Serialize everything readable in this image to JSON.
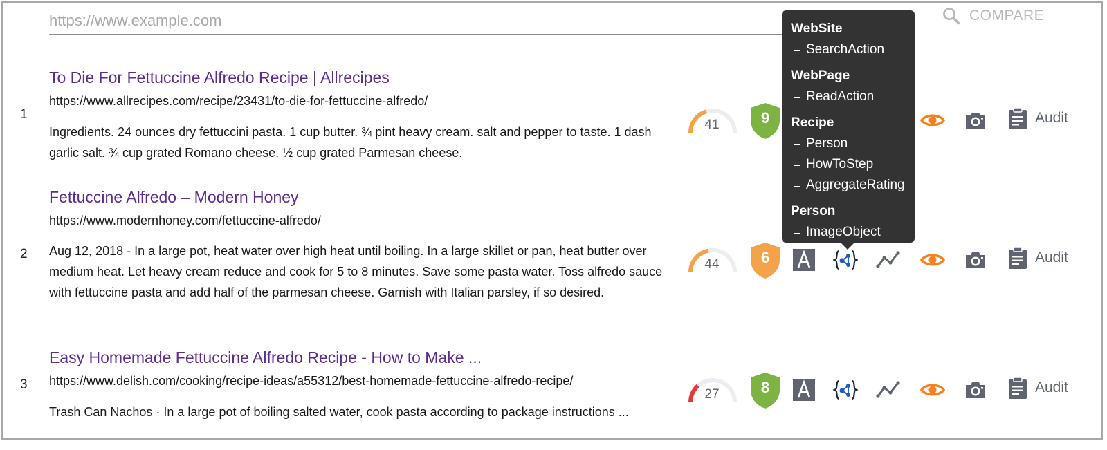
{
  "search": {
    "placeholder": "https://www.example.com",
    "value": ""
  },
  "compare_label": "COMPARE",
  "audit_label": "Audit",
  "colors": {
    "title": "#5c2d91",
    "gauge_orange": "#f5a34a",
    "gauge_red": "#e53935",
    "shield_green": "#7cb342",
    "shield_orange": "#f5a34a",
    "eye_orange": "#f5821f",
    "icon_gray": "#5f6470",
    "schema_blue": "#1e5bc6",
    "tooltip_bg": "#333333"
  },
  "results": [
    {
      "rank": "1",
      "title": "To Die For Fettuccine Alfredo Recipe | Allrecipes",
      "url": "https://www.allrecipes.com/recipe/23431/to-die-for-fettuccine-alfredo/",
      "snippet": "Ingredients. 24 ounces dry fettuccini pasta. 1 cup butter. ¾ pint heavy cream. salt and pepper to taste. 1 dash garlic salt. ¾ cup grated Romano cheese. ½ cup grated Parmesan cheese.",
      "score": "41",
      "score_fraction": 0.41,
      "score_level": "orange",
      "shield": "9",
      "shield_level": "green"
    },
    {
      "rank": "2",
      "title": "Fettuccine Alfredo – Modern Honey",
      "url": "https://www.modernhoney.com/fettuccine-alfredo/",
      "snippet": "Aug 12, 2018 - In a large pot, heat water over high heat until boiling. In a large skillet or pan, heat butter over medium heat. Let heavy cream reduce and cook for 5 to 8 minutes. Save some pasta water. Toss alfredo sauce with fettuccine pasta and add half of the parmesan cheese. Garnish with Italian parsley, if so desired.",
      "score": "44",
      "score_fraction": 0.44,
      "score_level": "orange",
      "shield": "6",
      "shield_level": "orange"
    },
    {
      "rank": "3",
      "title": "Easy Homemade Fettuccine Alfredo Recipe - How to Make ...",
      "url": "https://www.delish.com/cooking/recipe-ideas/a55312/best-homemade-fettuccine-alfredo-recipe/",
      "snippet": "Trash Can Nachos · In a large pot of boiling salted water, cook pasta according to package instructions ...",
      "score": "27",
      "score_fraction": 0.27,
      "score_level": "red",
      "shield": "8",
      "shield_level": "green"
    }
  ],
  "tooltip": [
    {
      "type": "WebSite",
      "children": [
        "SearchAction"
      ]
    },
    {
      "type": "WebPage",
      "children": [
        "ReadAction"
      ]
    },
    {
      "type": "Recipe",
      "children": [
        "Person",
        "HowToStep",
        "AggregateRating"
      ]
    },
    {
      "type": "Person",
      "children": [
        "ImageObject"
      ]
    }
  ],
  "icons": [
    "search-icon",
    "gauge-icon",
    "shield-icon",
    "font-icon",
    "schema-icon",
    "trend-icon",
    "eye-icon",
    "camera-icon",
    "clipboard-icon"
  ]
}
